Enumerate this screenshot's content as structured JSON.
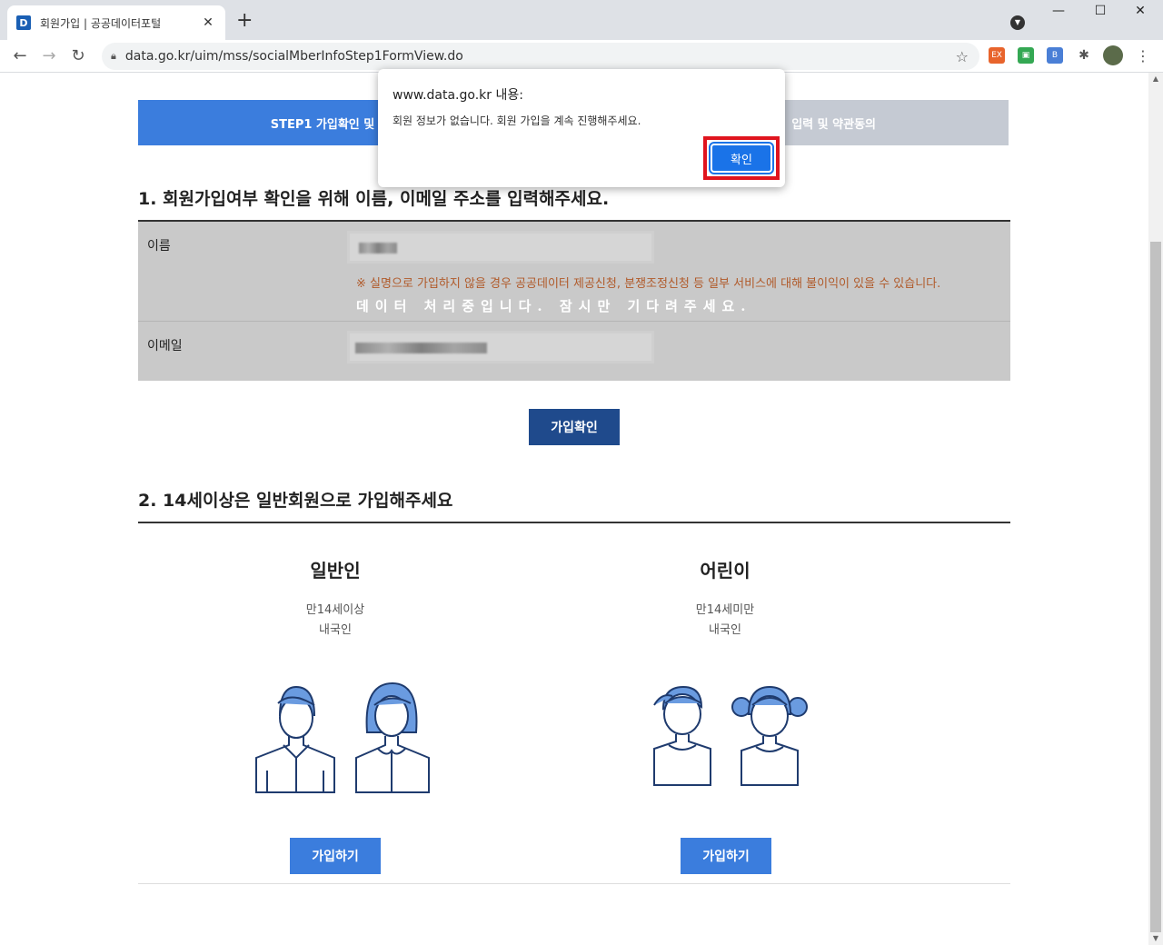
{
  "browser": {
    "tab_title": "회원가입 | 공공데이터포털",
    "favicon_letter": "D",
    "tab_close": "✕",
    "new_tab": "+",
    "url": "data.go.kr/uim/mss/socialMberInfoStep1FormView.do",
    "window_controls": [
      "—",
      "☐",
      "✕"
    ],
    "extensions": [
      {
        "name": "ex-extension",
        "label": "EX",
        "color": "#e8642c"
      },
      {
        "name": "green-extension",
        "label": "▣",
        "color": "#34a853"
      },
      {
        "name": "blue-extension",
        "label": "B",
        "color": "#4a7fd6"
      }
    ]
  },
  "steps": [
    {
      "label": "STEP1  가입확인 및",
      "active": true
    },
    {
      "label": "입력 및 약관동의",
      "active": false
    }
  ],
  "section1": {
    "title": "1. 회원가입여부 확인을 위해 이름, 이메일 주소를 입력해주세요.",
    "name_label": "이름",
    "email_label": "이메일",
    "notice": "※ 실명으로 가입하지 않을 경우 공공데이터 제공신청, 분쟁조정신청 등 일부 서비스에 대해 불이익이 있을 수 있습니다.",
    "processing": "데이터 처리중입니다. 잠시만 기다려주세요.",
    "confirm_button": "가입확인"
  },
  "section2": {
    "title": "2. 14세이상은 일반회원으로 가입해주세요",
    "members": [
      {
        "title": "일반인",
        "desc1": "만14세이상",
        "desc2": "내국인",
        "button": "가입하기"
      },
      {
        "title": "어린이",
        "desc1": "만14세미만",
        "desc2": "내국인",
        "button": "가입하기"
      }
    ]
  },
  "dialog": {
    "title": "www.data.go.kr 내용:",
    "message": "회원 정보가 없습니다. 회원 가입을 계속 진행해주세요.",
    "ok_button": "확인"
  },
  "colors": {
    "accent_blue": "#3b7ddd",
    "dark_blue": "#1f4a8c",
    "highlight_red": "#e0141e",
    "overlay_gray": "#c9c9c9"
  }
}
